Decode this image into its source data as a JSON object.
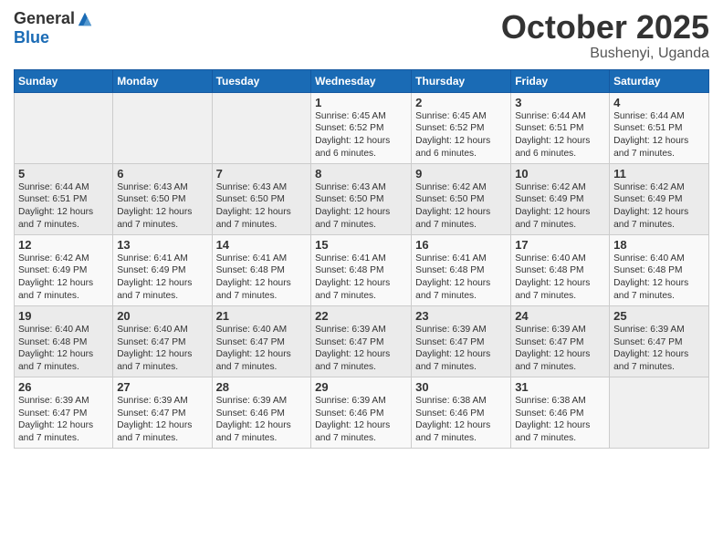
{
  "header": {
    "logo_general": "General",
    "logo_blue": "Blue",
    "month_title": "October 2025",
    "location": "Bushenyi, Uganda"
  },
  "days_of_week": [
    "Sunday",
    "Monday",
    "Tuesday",
    "Wednesday",
    "Thursday",
    "Friday",
    "Saturday"
  ],
  "weeks": [
    [
      {
        "day": "",
        "info": ""
      },
      {
        "day": "",
        "info": ""
      },
      {
        "day": "",
        "info": ""
      },
      {
        "day": "1",
        "info": "Sunrise: 6:45 AM\nSunset: 6:52 PM\nDaylight: 12 hours\nand 6 minutes."
      },
      {
        "day": "2",
        "info": "Sunrise: 6:45 AM\nSunset: 6:52 PM\nDaylight: 12 hours\nand 6 minutes."
      },
      {
        "day": "3",
        "info": "Sunrise: 6:44 AM\nSunset: 6:51 PM\nDaylight: 12 hours\nand 6 minutes."
      },
      {
        "day": "4",
        "info": "Sunrise: 6:44 AM\nSunset: 6:51 PM\nDaylight: 12 hours\nand 7 minutes."
      }
    ],
    [
      {
        "day": "5",
        "info": "Sunrise: 6:44 AM\nSunset: 6:51 PM\nDaylight: 12 hours\nand 7 minutes."
      },
      {
        "day": "6",
        "info": "Sunrise: 6:43 AM\nSunset: 6:50 PM\nDaylight: 12 hours\nand 7 minutes."
      },
      {
        "day": "7",
        "info": "Sunrise: 6:43 AM\nSunset: 6:50 PM\nDaylight: 12 hours\nand 7 minutes."
      },
      {
        "day": "8",
        "info": "Sunrise: 6:43 AM\nSunset: 6:50 PM\nDaylight: 12 hours\nand 7 minutes."
      },
      {
        "day": "9",
        "info": "Sunrise: 6:42 AM\nSunset: 6:50 PM\nDaylight: 12 hours\nand 7 minutes."
      },
      {
        "day": "10",
        "info": "Sunrise: 6:42 AM\nSunset: 6:49 PM\nDaylight: 12 hours\nand 7 minutes."
      },
      {
        "day": "11",
        "info": "Sunrise: 6:42 AM\nSunset: 6:49 PM\nDaylight: 12 hours\nand 7 minutes."
      }
    ],
    [
      {
        "day": "12",
        "info": "Sunrise: 6:42 AM\nSunset: 6:49 PM\nDaylight: 12 hours\nand 7 minutes."
      },
      {
        "day": "13",
        "info": "Sunrise: 6:41 AM\nSunset: 6:49 PM\nDaylight: 12 hours\nand 7 minutes."
      },
      {
        "day": "14",
        "info": "Sunrise: 6:41 AM\nSunset: 6:48 PM\nDaylight: 12 hours\nand 7 minutes."
      },
      {
        "day": "15",
        "info": "Sunrise: 6:41 AM\nSunset: 6:48 PM\nDaylight: 12 hours\nand 7 minutes."
      },
      {
        "day": "16",
        "info": "Sunrise: 6:41 AM\nSunset: 6:48 PM\nDaylight: 12 hours\nand 7 minutes."
      },
      {
        "day": "17",
        "info": "Sunrise: 6:40 AM\nSunset: 6:48 PM\nDaylight: 12 hours\nand 7 minutes."
      },
      {
        "day": "18",
        "info": "Sunrise: 6:40 AM\nSunset: 6:48 PM\nDaylight: 12 hours\nand 7 minutes."
      }
    ],
    [
      {
        "day": "19",
        "info": "Sunrise: 6:40 AM\nSunset: 6:48 PM\nDaylight: 12 hours\nand 7 minutes."
      },
      {
        "day": "20",
        "info": "Sunrise: 6:40 AM\nSunset: 6:47 PM\nDaylight: 12 hours\nand 7 minutes."
      },
      {
        "day": "21",
        "info": "Sunrise: 6:40 AM\nSunset: 6:47 PM\nDaylight: 12 hours\nand 7 minutes."
      },
      {
        "day": "22",
        "info": "Sunrise: 6:39 AM\nSunset: 6:47 PM\nDaylight: 12 hours\nand 7 minutes."
      },
      {
        "day": "23",
        "info": "Sunrise: 6:39 AM\nSunset: 6:47 PM\nDaylight: 12 hours\nand 7 minutes."
      },
      {
        "day": "24",
        "info": "Sunrise: 6:39 AM\nSunset: 6:47 PM\nDaylight: 12 hours\nand 7 minutes."
      },
      {
        "day": "25",
        "info": "Sunrise: 6:39 AM\nSunset: 6:47 PM\nDaylight: 12 hours\nand 7 minutes."
      }
    ],
    [
      {
        "day": "26",
        "info": "Sunrise: 6:39 AM\nSunset: 6:47 PM\nDaylight: 12 hours\nand 7 minutes."
      },
      {
        "day": "27",
        "info": "Sunrise: 6:39 AM\nSunset: 6:47 PM\nDaylight: 12 hours\nand 7 minutes."
      },
      {
        "day": "28",
        "info": "Sunrise: 6:39 AM\nSunset: 6:46 PM\nDaylight: 12 hours\nand 7 minutes."
      },
      {
        "day": "29",
        "info": "Sunrise: 6:39 AM\nSunset: 6:46 PM\nDaylight: 12 hours\nand 7 minutes."
      },
      {
        "day": "30",
        "info": "Sunrise: 6:38 AM\nSunset: 6:46 PM\nDaylight: 12 hours\nand 7 minutes."
      },
      {
        "day": "31",
        "info": "Sunrise: 6:38 AM\nSunset: 6:46 PM\nDaylight: 12 hours\nand 7 minutes."
      },
      {
        "day": "",
        "info": ""
      }
    ]
  ]
}
